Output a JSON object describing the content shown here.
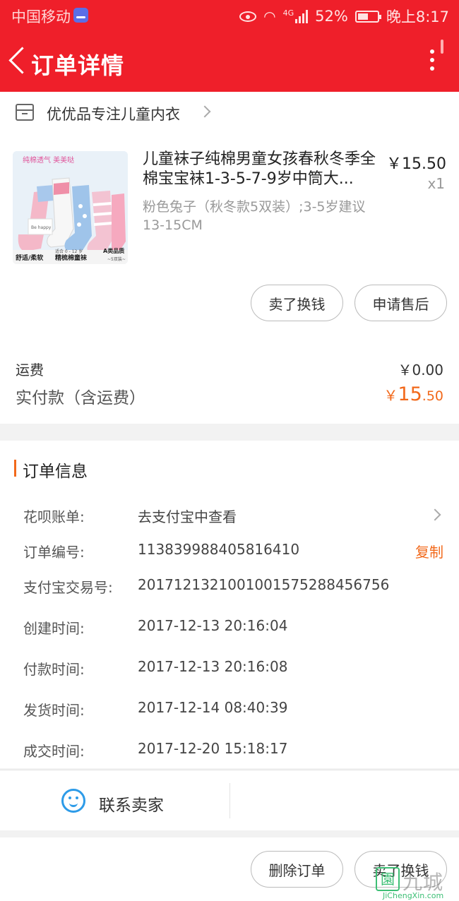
{
  "status_bar": {
    "carrier": "中国移动",
    "network": "4G",
    "battery": "52%",
    "time": "晚上8:17"
  },
  "header": {
    "title": "订单详情"
  },
  "shop": {
    "name": "优优品专注儿童内衣"
  },
  "product": {
    "title": "儿童袜子纯棉男童女孩春秋冬季全棉宝宝袜1-3-5-7-9岁中筒大...",
    "price": "￥15.50",
    "quantity": "x1",
    "sku": "粉色兔子（秋冬款5双装）;3-5岁建议13-15CM",
    "image_texts": {
      "banner": "纯棉透气 美美哒",
      "card": "Be happy",
      "grade": "A类品质",
      "pack": "~5双装~",
      "age": "适合 0 - 12 岁",
      "bottom_left": "舒适/柔软",
      "bottom_right": "精梳棉童袜"
    }
  },
  "actions": {
    "sell": "卖了换钱",
    "after_sale": "申请售后"
  },
  "summary": {
    "freight_label": "运费",
    "freight_value": "￥0.00",
    "paid_label": "实付款（含运费）",
    "paid_currency": "￥",
    "paid_int": "15",
    "paid_dec": ".50"
  },
  "order_info": {
    "section_title": "订单信息",
    "huabei_label": "花呗账单:",
    "huabei_value": "去支付宝中查看",
    "order_no_label": "订单编号:",
    "order_no_value": "113839988405816410",
    "copy": "复制",
    "alipay_label": "支付宝交易号:",
    "alipay_value": "2017121321001001575288456756",
    "created_label": "创建时间:",
    "created_value": "2017-12-13 20:16:04",
    "paid_time_label": "付款时间:",
    "paid_time_value": "2017-12-13 20:16:08",
    "shipped_label": "发货时间:",
    "shipped_value": "2017-12-14 08:40:39",
    "closed_label": "成交时间:",
    "closed_value": "2017-12-20 15:18:17"
  },
  "contact": {
    "label": "联系卖家"
  },
  "bottom_bar": {
    "delete": "删除订单",
    "sell": "卖了换钱"
  },
  "watermark": {
    "icon": "園",
    "name": "九城网",
    "url": "JiChengXin.com"
  },
  "colors": {
    "header_red": "#ef1f2a",
    "accent_orange": "#f2691b",
    "contact_blue": "#2d9be8"
  }
}
